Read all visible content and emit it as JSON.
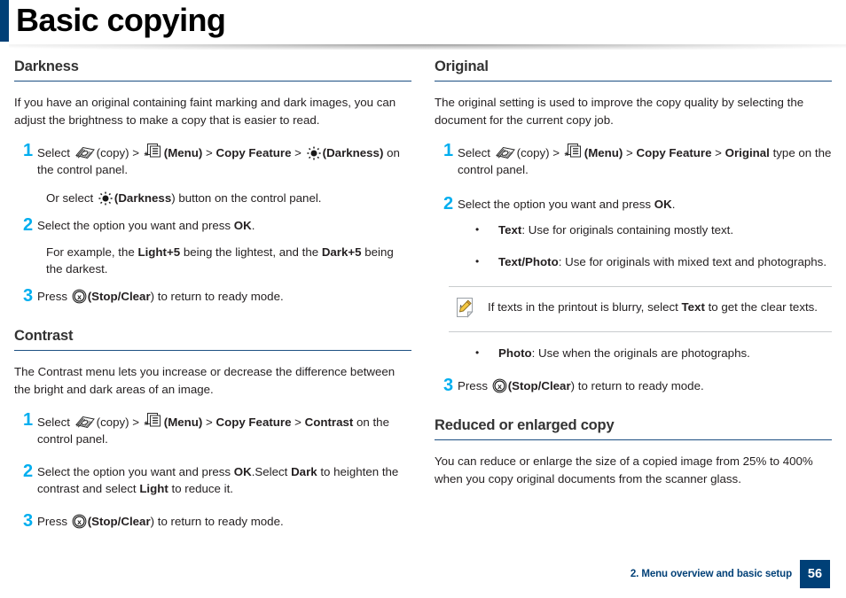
{
  "page": {
    "title": "Basic copying",
    "accent_color": "#004077",
    "step_number_color": "#00aeef",
    "heading_rule_color": "#1c4f82"
  },
  "footer": {
    "chapter": "2. Menu overview and basic setup",
    "page_number": "56"
  },
  "left_column": {
    "sections": [
      {
        "heading": "Darkness",
        "intro": "If you have an original containing faint marking and dark images, you can adjust the brightness to make a copy that is easier to read.",
        "steps": [
          {
            "num": "1",
            "text_parts": [
              {
                "t": "Select ",
                "b": false
              },
              {
                "icon": "copy-stack-icon"
              },
              {
                "t": "(copy) > ",
                "b": false
              },
              {
                "icon": "menu-icon"
              },
              {
                "t": "(Menu)",
                "b": true
              },
              {
                "t": " > ",
                "b": false
              },
              {
                "t": "Copy Feature",
                "b": true
              },
              {
                "t": " > ",
                "b": false
              },
              {
                "icon": "brightness-icon"
              },
              {
                "t": "(Darkness)",
                "b": true
              },
              {
                "t": " on the control panel.",
                "b": false
              }
            ]
          },
          {
            "num": "2",
            "text_parts": [
              {
                "t": "Select the option you want and press ",
                "b": false
              },
              {
                "t": "OK",
                "b": true
              },
              {
                "t": ".",
                "b": false
              }
            ]
          },
          {
            "num": "3",
            "text_parts": [
              {
                "t": "Press ",
                "b": false
              },
              {
                "icon": "stop-clear-icon"
              },
              {
                "t": "(Stop/Clear",
                "b": true
              },
              {
                "t": ") to return to ready mode.",
                "b": false
              }
            ]
          }
        ],
        "sub_paragraphs": {
          "after_step1": [
            {
              "t": "Or select ",
              "b": false
            },
            {
              "icon": "brightness-icon"
            },
            {
              "t": "(Darkness",
              "b": true
            },
            {
              "t": ") button on the control panel.",
              "b": false
            }
          ],
          "after_step2": [
            {
              "t": "For example, the ",
              "b": false
            },
            {
              "t": "Light+5",
              "b": true
            },
            {
              "t": " being the lightest, and the ",
              "b": false
            },
            {
              "t": "Dark+5",
              "b": true
            },
            {
              "t": " being the darkest.",
              "b": false
            }
          ]
        }
      },
      {
        "heading": "Contrast",
        "intro": "The Contrast menu lets you increase or decrease the difference between the bright and dark areas of an image.",
        "steps": [
          {
            "num": "1",
            "text_parts": [
              {
                "t": "Select ",
                "b": false
              },
              {
                "icon": "copy-stack-icon"
              },
              {
                "t": "(copy) > ",
                "b": false
              },
              {
                "icon": "menu-icon"
              },
              {
                "t": "(Menu)",
                "b": true
              },
              {
                "t": " > ",
                "b": false
              },
              {
                "t": "Copy Feature",
                "b": true
              },
              {
                "t": " > ",
                "b": false
              },
              {
                "t": "Contrast",
                "b": true
              },
              {
                "t": " on the control panel.",
                "b": false
              }
            ]
          },
          {
            "num": "2",
            "text_parts": [
              {
                "t": "Select the option you want and press ",
                "b": false
              },
              {
                "t": "OK",
                "b": true
              },
              {
                "t": ".Select ",
                "b": false
              },
              {
                "t": "Dark",
                "b": true
              },
              {
                "t": " to heighten the contrast and select ",
                "b": false
              },
              {
                "t": "Light",
                "b": true
              },
              {
                "t": " to reduce it.",
                "b": false
              }
            ]
          },
          {
            "num": "3",
            "text_parts": [
              {
                "t": "Press ",
                "b": false
              },
              {
                "icon": "stop-clear-icon"
              },
              {
                "t": "(Stop/Clear",
                "b": true
              },
              {
                "t": ") to return to ready mode.",
                "b": false
              }
            ]
          }
        ]
      }
    ]
  },
  "right_column": {
    "sections": [
      {
        "heading": "Original",
        "intro": "The original setting is used to improve the copy quality by selecting the document for the current copy job.",
        "steps": [
          {
            "num": "1",
            "text_parts": [
              {
                "t": "Select ",
                "b": false
              },
              {
                "icon": "copy-stack-icon"
              },
              {
                "t": "(copy) > ",
                "b": false
              },
              {
                "icon": "menu-icon"
              },
              {
                "t": "(Menu)",
                "b": true
              },
              {
                "t": " > ",
                "b": false
              },
              {
                "t": "Copy Feature",
                "b": true
              },
              {
                "t": " > ",
                "b": false
              },
              {
                "t": "Original",
                "b": true
              },
              {
                "t": " type on the control panel.",
                "b": false
              }
            ]
          },
          {
            "num": "2",
            "text_parts": [
              {
                "t": "Select the option you want and press ",
                "b": false
              },
              {
                "t": "OK",
                "b": true
              },
              {
                "t": ".",
                "b": false
              }
            ]
          },
          {
            "num": "3",
            "text_parts": [
              {
                "t": "Press ",
                "b": false
              },
              {
                "icon": "stop-clear-icon"
              },
              {
                "t": "(Stop/Clear",
                "b": true
              },
              {
                "t": ") to return to ready mode.",
                "b": false
              }
            ]
          }
        ],
        "bullets_before_note": [
          {
            "marker": "•",
            "parts": [
              {
                "t": "Text",
                "b": true
              },
              {
                "t": ": Use for originals containing mostly text.",
                "b": false
              }
            ]
          },
          {
            "marker": "•",
            "parts": [
              {
                "t": "Text/Photo",
                "b": true
              },
              {
                "t": ": Use for originals with mixed text and photographs.",
                "b": false
              }
            ]
          }
        ],
        "note": {
          "icon": "note-pencil-icon",
          "parts": [
            {
              "t": "If texts in the printout is blurry, select ",
              "b": false
            },
            {
              "t": "Text",
              "b": true
            },
            {
              "t": " to get the clear texts.",
              "b": false
            }
          ]
        },
        "bullets_after_note": [
          {
            "marker": "•",
            "parts": [
              {
                "t": "Photo",
                "b": true
              },
              {
                "t": ": Use when the originals are photographs.",
                "b": false
              }
            ]
          }
        ]
      },
      {
        "heading": "Reduced or enlarged copy",
        "intro": "You can reduce or enlarge the size of a copied image from 25% to 400% when you copy original documents from the scanner glass."
      }
    ]
  }
}
